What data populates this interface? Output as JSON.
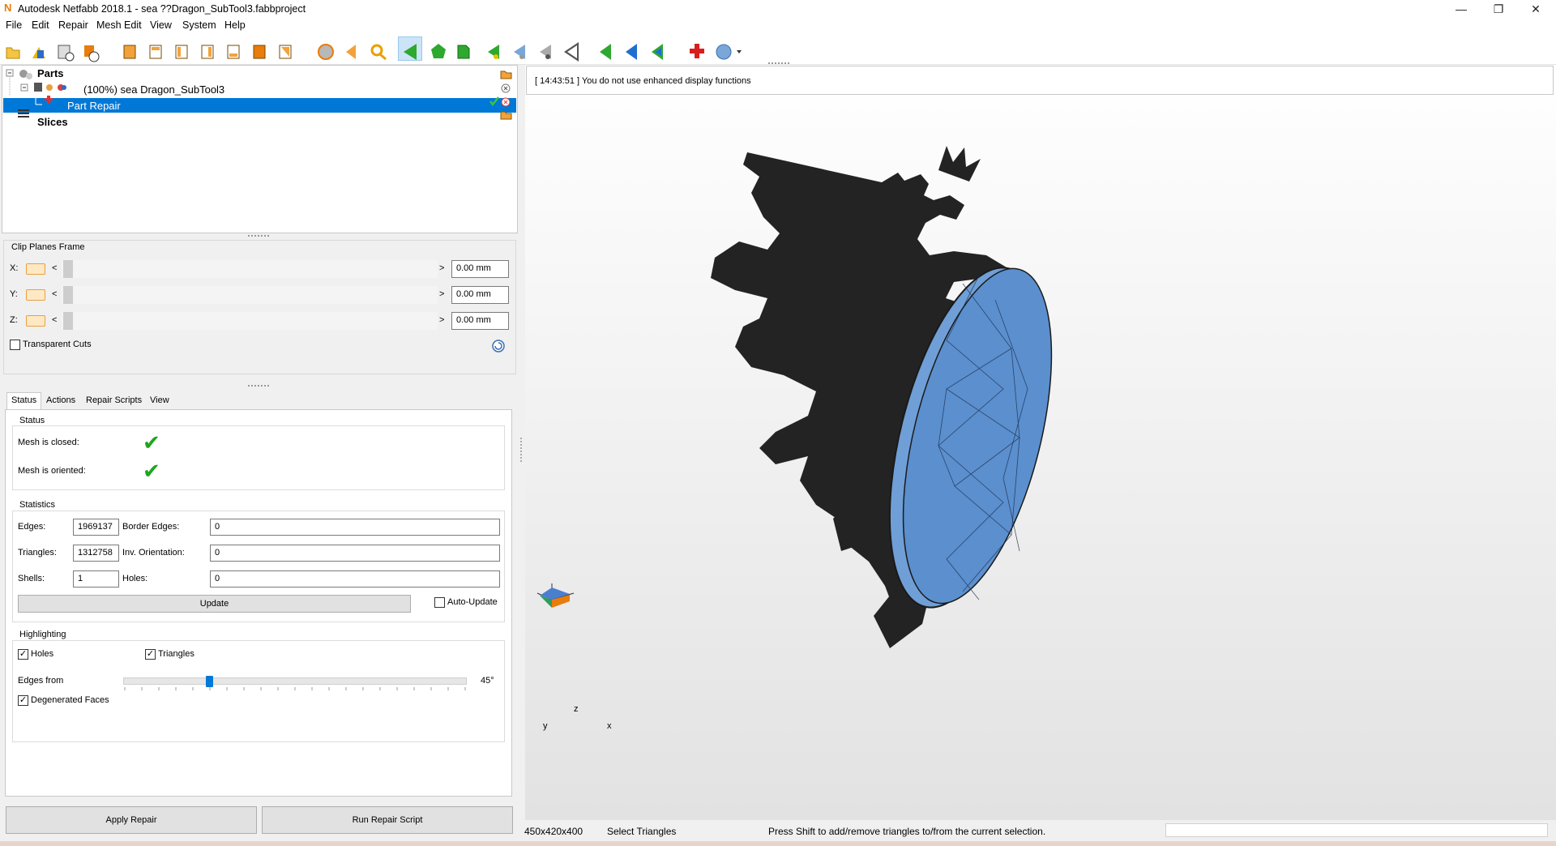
{
  "window": {
    "title": "Autodesk Netfabb 2018.1 - sea ??Dragon_SubTool3.fabbproject",
    "app_icon": "N",
    "controls": [
      "minimize-icon",
      "restore-icon",
      "close-icon"
    ]
  },
  "menu": [
    "File",
    "Edit",
    "Repair",
    "Mesh Edit",
    "View",
    "System",
    "Help"
  ],
  "toolbar": {
    "icons": [
      "open-project-icon",
      "add-part-icon",
      "part-info-icon",
      "add-object-icon",
      "view-front-icon",
      "view-back-icon",
      "view-left-icon",
      "view-right-icon",
      "view-top-icon",
      "view-bottom-icon",
      "view-iso-icon",
      "sphere-icon",
      "arrow-left-icon",
      "search-icon",
      "select-triangles-icon",
      "select-surface-icon",
      "select-shell-icon",
      "add-triangle-icon",
      "remove-triangle-icon",
      "invert-selection-icon",
      "cut-icon",
      "move-icon",
      "rotate-icon",
      "scale-icon",
      "repair-cross-icon",
      "help-icon"
    ]
  },
  "tree": {
    "root": "Parts",
    "part": "(100%) sea Dragon_SubTool3",
    "repair": "Part Repair",
    "slices": "Slices"
  },
  "clip": {
    "title": "Clip Planes Frame",
    "axes": [
      {
        "label": "X:",
        "value": "0.00 mm"
      },
      {
        "label": "Y:",
        "value": "0.00 mm"
      },
      {
        "label": "Z:",
        "value": "0.00 mm"
      }
    ],
    "transparent_cuts": "Transparent Cuts"
  },
  "tabs": [
    "Status",
    "Actions",
    "Repair Scripts",
    "View"
  ],
  "status": {
    "title": "Status",
    "closed": "Mesh is closed:",
    "oriented": "Mesh is oriented:"
  },
  "statistics": {
    "title": "Statistics",
    "edges_label": "Edges:",
    "edges": "1969137",
    "border_label": "Border Edges:",
    "border": "0",
    "triangles_label": "Triangles:",
    "triangles": "1312758",
    "inv_label": "Inv. Orientation:",
    "inv": "0",
    "shells_label": "Shells:",
    "shells": "1",
    "holes_label": "Holes:",
    "holes": "0",
    "update": "Update",
    "auto_update": "Auto-Update"
  },
  "highlighting": {
    "title": "Highlighting",
    "holes": "Holes",
    "triangles": "Triangles",
    "edges_from": "Edges from",
    "angle": "45°",
    "angle_fraction": 0.25,
    "degenerated": "Degenerated Faces"
  },
  "buttons": {
    "apply": "Apply Repair",
    "run_script": "Run Repair Script"
  },
  "console": "[ 14:43:51 ] You do not use enhanced display functions",
  "axes_gizmo": {
    "z": "z",
    "y": "y",
    "x": "x"
  },
  "statusbar": {
    "dims": "450x420x400",
    "mode": "Select Triangles",
    "hint": "Press Shift to add/remove triangles to/from the current selection."
  },
  "colors": {
    "selection": "#0078d7",
    "model_dark": "#232323",
    "disc_blue": "#5b8fce",
    "check_green": "#1fa51f"
  }
}
